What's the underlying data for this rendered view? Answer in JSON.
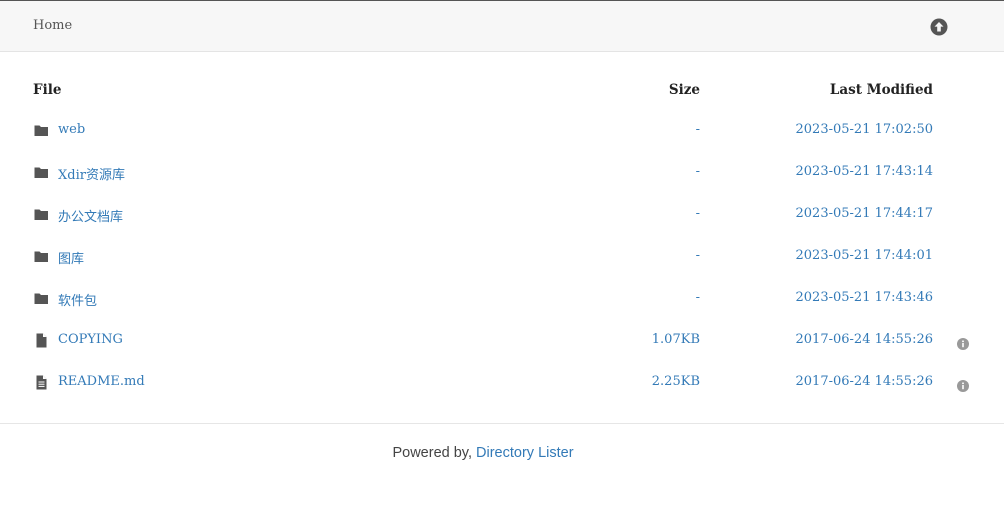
{
  "breadcrumb": {
    "home_label": "Home"
  },
  "top_button": {
    "icon": "arrow-circle-up-icon"
  },
  "columns": {
    "file": "File",
    "size": "Size",
    "modified": "Last Modified"
  },
  "entries": [
    {
      "type": "folder",
      "name": "web",
      "size": "-",
      "modified": "2023-05-21 17:02:50",
      "info": false
    },
    {
      "type": "folder",
      "name": "Xdir资源库",
      "size": "-",
      "modified": "2023-05-21 17:43:14",
      "info": false
    },
    {
      "type": "folder",
      "name": "办公文档库",
      "size": "-",
      "modified": "2023-05-21 17:44:17",
      "info": false
    },
    {
      "type": "folder",
      "name": "图库",
      "size": "-",
      "modified": "2023-05-21 17:44:01",
      "info": false
    },
    {
      "type": "folder",
      "name": "软件包",
      "size": "-",
      "modified": "2023-05-21 17:43:46",
      "info": false
    },
    {
      "type": "file",
      "name": "COPYING",
      "size": "1.07KB",
      "modified": "2017-06-24 14:55:26",
      "info": true
    },
    {
      "type": "file-text",
      "name": "README.md",
      "size": "2.25KB",
      "modified": "2017-06-24 14:55:26",
      "info": true
    }
  ],
  "footer": {
    "prefix": "Powered by, ",
    "link_text": "Directory Lister"
  },
  "colors": {
    "link": "#337ab7",
    "icon": "#555555",
    "info_icon": "#999999",
    "topbar_bg": "#f7f7f7"
  }
}
